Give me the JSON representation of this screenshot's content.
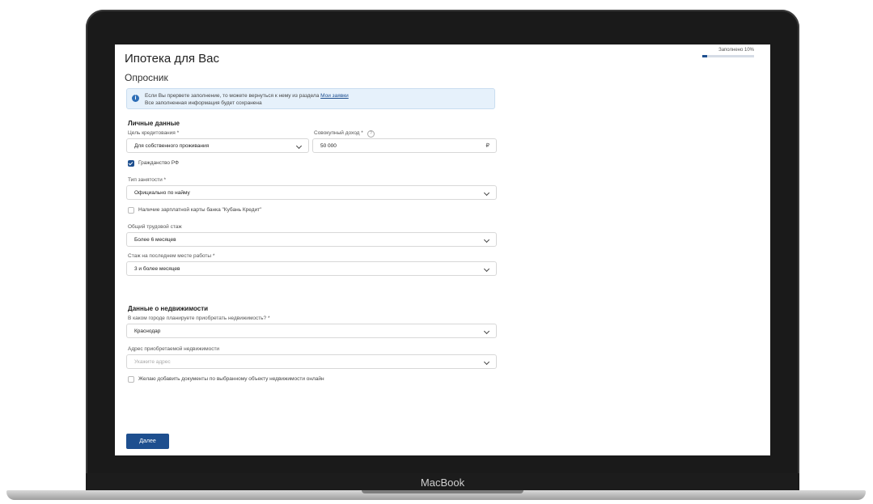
{
  "device": {
    "brand_label": "MacBook"
  },
  "progress": {
    "label": "Заполнено 10%",
    "value_percent": 10
  },
  "page": {
    "title": "Ипотека для Вас",
    "subtitle": "Опросник"
  },
  "notice": {
    "line1": "Если Вы прервете заполнение, то можете вернуться к нему из раздела",
    "link": "Мои заявки",
    "line2": "Все заполненная информация будет сохранена"
  },
  "personal": {
    "heading": "Личные данные",
    "purpose_label": "Цель кредитования *",
    "purpose_value": "Для собственного проживания",
    "income_label": "Совокупный доход *",
    "income_value": "50 000",
    "income_currency": "₽",
    "citizenship_label": "Гражданство РФ",
    "employment_label": "Тип занятости *",
    "employment_value": "Официально по найму",
    "salary_card_label": "Наличие зарплатной карты банка \"Кубань Кредит\"",
    "experience_label": "Общий трудовой стаж",
    "experience_value": "Более 6 месяцев",
    "last_job_label": "Стаж на последнем месте работы *",
    "last_job_value": "3 и более месяцев"
  },
  "property": {
    "heading": "Данные о недвижимости",
    "city_label": "В каком городе планируете приобретать недвижимость? *",
    "city_value": "Краснодар",
    "address_label": "Адрес приобретаемой недвижимости",
    "address_placeholder": "Укажите адрес",
    "docs_label": "Желаю добавить документы по выбранному объекту недвижимости онлайн"
  },
  "actions": {
    "next_label": "Далее"
  }
}
